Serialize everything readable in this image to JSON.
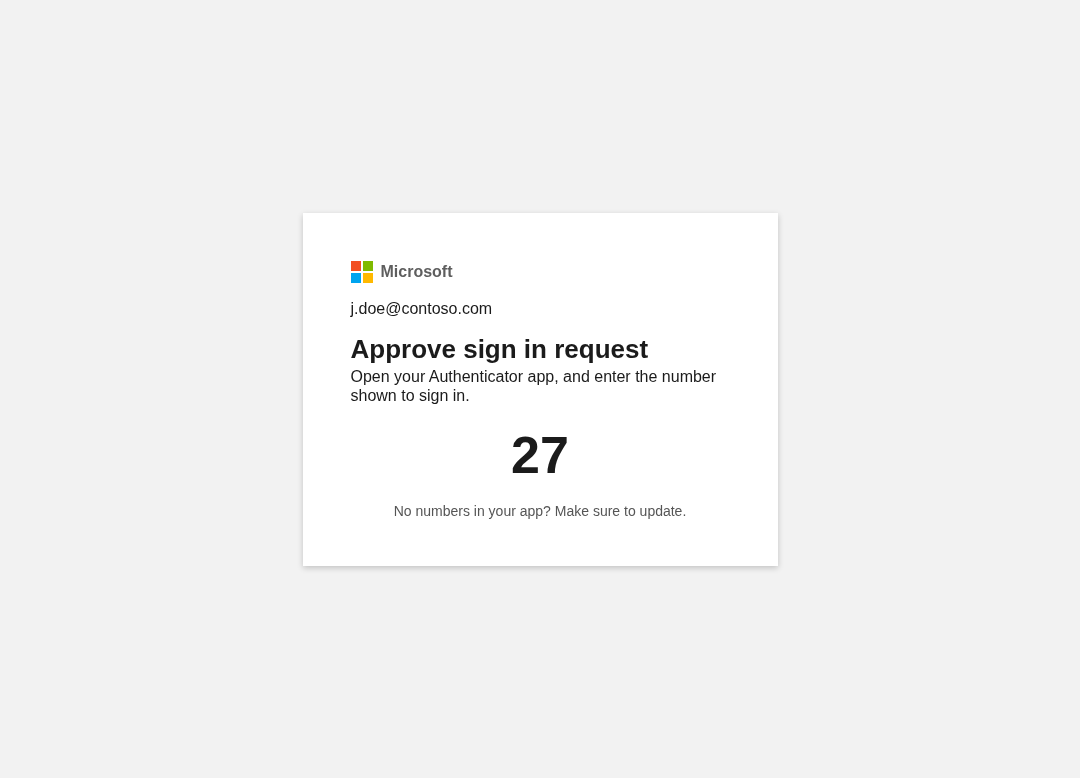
{
  "brand": {
    "name": "Microsoft"
  },
  "account": "j.doe@contoso.com",
  "title": "Approve sign in request",
  "description": "Open your Authenticator app, and enter the number shown to sign in.",
  "number": "27",
  "footer_note": "No numbers in your app? Make sure to update."
}
